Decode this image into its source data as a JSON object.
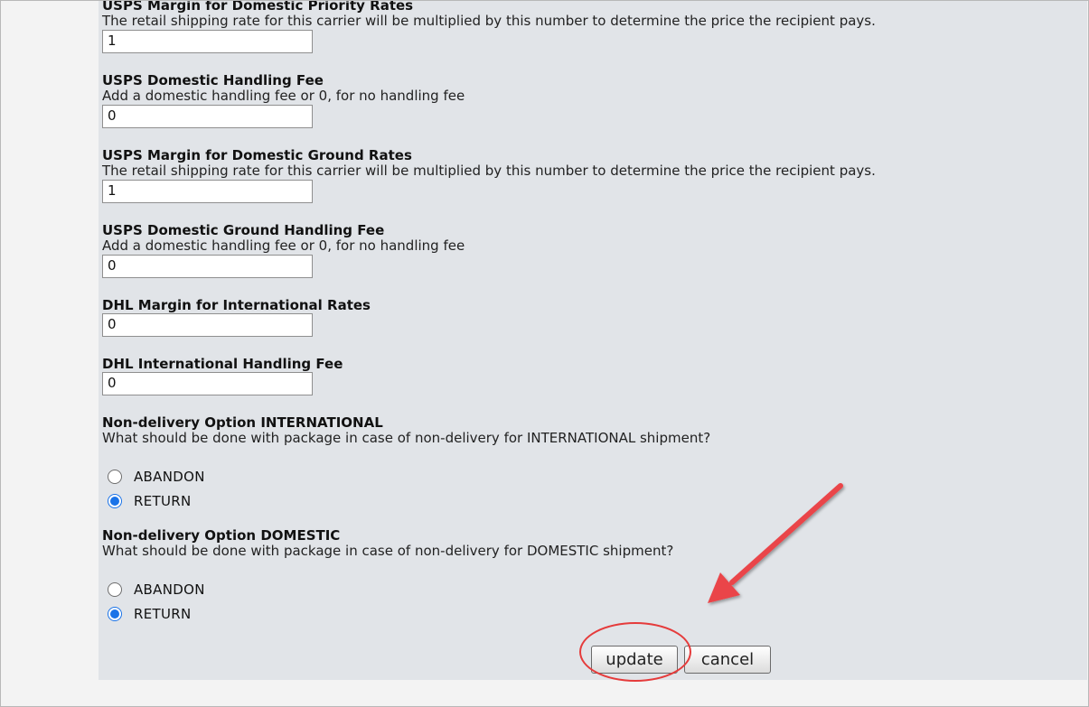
{
  "fields": [
    {
      "title": "USPS Margin for Domestic Priority Rates",
      "desc": "The retail shipping rate for this carrier will be multiplied by this number to determine the price the recipient pays.",
      "value": "1"
    },
    {
      "title": "USPS Domestic Handling Fee",
      "desc": "Add a domestic handling fee or 0, for no handling fee",
      "value": "0"
    },
    {
      "title": "USPS Margin for Domestic Ground Rates",
      "desc": "The retail shipping rate for this carrier will be multiplied by this number to determine the price the recipient pays.",
      "value": "1"
    },
    {
      "title": "USPS Domestic Ground Handling Fee",
      "desc": "Add a domestic handling fee or 0, for no handling fee",
      "value": "0"
    },
    {
      "title": "DHL Margin for International Rates",
      "value": "0"
    },
    {
      "title": "DHL International Handling Fee",
      "value": "0"
    }
  ],
  "nondelivery_international": {
    "title": "Non-delivery Option INTERNATIONAL",
    "desc": "What should be done with package in case of non-delivery for INTERNATIONAL shipment?",
    "options": [
      "ABANDON",
      "RETURN"
    ],
    "selected": "RETURN"
  },
  "nondelivery_domestic": {
    "title": "Non-delivery Option DOMESTIC",
    "desc": "What should be done with package in case of non-delivery for DOMESTIC shipment?",
    "options": [
      "ABANDON",
      "RETURN"
    ],
    "selected": "RETURN"
  },
  "buttons": {
    "update": "update",
    "cancel": "cancel"
  },
  "annotation": {
    "color": "#e53b3b"
  }
}
